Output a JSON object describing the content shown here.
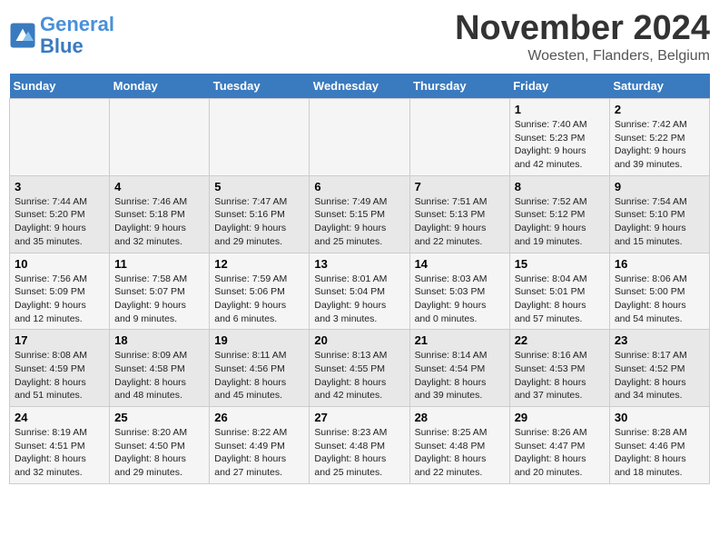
{
  "header": {
    "logo_line1": "General",
    "logo_line2": "Blue",
    "month": "November 2024",
    "location": "Woesten, Flanders, Belgium"
  },
  "days_of_week": [
    "Sunday",
    "Monday",
    "Tuesday",
    "Wednesday",
    "Thursday",
    "Friday",
    "Saturday"
  ],
  "weeks": [
    [
      {
        "day": "",
        "info": ""
      },
      {
        "day": "",
        "info": ""
      },
      {
        "day": "",
        "info": ""
      },
      {
        "day": "",
        "info": ""
      },
      {
        "day": "",
        "info": ""
      },
      {
        "day": "1",
        "info": "Sunrise: 7:40 AM\nSunset: 5:23 PM\nDaylight: 9 hours\nand 42 minutes."
      },
      {
        "day": "2",
        "info": "Sunrise: 7:42 AM\nSunset: 5:22 PM\nDaylight: 9 hours\nand 39 minutes."
      }
    ],
    [
      {
        "day": "3",
        "info": "Sunrise: 7:44 AM\nSunset: 5:20 PM\nDaylight: 9 hours\nand 35 minutes."
      },
      {
        "day": "4",
        "info": "Sunrise: 7:46 AM\nSunset: 5:18 PM\nDaylight: 9 hours\nand 32 minutes."
      },
      {
        "day": "5",
        "info": "Sunrise: 7:47 AM\nSunset: 5:16 PM\nDaylight: 9 hours\nand 29 minutes."
      },
      {
        "day": "6",
        "info": "Sunrise: 7:49 AM\nSunset: 5:15 PM\nDaylight: 9 hours\nand 25 minutes."
      },
      {
        "day": "7",
        "info": "Sunrise: 7:51 AM\nSunset: 5:13 PM\nDaylight: 9 hours\nand 22 minutes."
      },
      {
        "day": "8",
        "info": "Sunrise: 7:52 AM\nSunset: 5:12 PM\nDaylight: 9 hours\nand 19 minutes."
      },
      {
        "day": "9",
        "info": "Sunrise: 7:54 AM\nSunset: 5:10 PM\nDaylight: 9 hours\nand 15 minutes."
      }
    ],
    [
      {
        "day": "10",
        "info": "Sunrise: 7:56 AM\nSunset: 5:09 PM\nDaylight: 9 hours\nand 12 minutes."
      },
      {
        "day": "11",
        "info": "Sunrise: 7:58 AM\nSunset: 5:07 PM\nDaylight: 9 hours\nand 9 minutes."
      },
      {
        "day": "12",
        "info": "Sunrise: 7:59 AM\nSunset: 5:06 PM\nDaylight: 9 hours\nand 6 minutes."
      },
      {
        "day": "13",
        "info": "Sunrise: 8:01 AM\nSunset: 5:04 PM\nDaylight: 9 hours\nand 3 minutes."
      },
      {
        "day": "14",
        "info": "Sunrise: 8:03 AM\nSunset: 5:03 PM\nDaylight: 9 hours\nand 0 minutes."
      },
      {
        "day": "15",
        "info": "Sunrise: 8:04 AM\nSunset: 5:01 PM\nDaylight: 8 hours\nand 57 minutes."
      },
      {
        "day": "16",
        "info": "Sunrise: 8:06 AM\nSunset: 5:00 PM\nDaylight: 8 hours\nand 54 minutes."
      }
    ],
    [
      {
        "day": "17",
        "info": "Sunrise: 8:08 AM\nSunset: 4:59 PM\nDaylight: 8 hours\nand 51 minutes."
      },
      {
        "day": "18",
        "info": "Sunrise: 8:09 AM\nSunset: 4:58 PM\nDaylight: 8 hours\nand 48 minutes."
      },
      {
        "day": "19",
        "info": "Sunrise: 8:11 AM\nSunset: 4:56 PM\nDaylight: 8 hours\nand 45 minutes."
      },
      {
        "day": "20",
        "info": "Sunrise: 8:13 AM\nSunset: 4:55 PM\nDaylight: 8 hours\nand 42 minutes."
      },
      {
        "day": "21",
        "info": "Sunrise: 8:14 AM\nSunset: 4:54 PM\nDaylight: 8 hours\nand 39 minutes."
      },
      {
        "day": "22",
        "info": "Sunrise: 8:16 AM\nSunset: 4:53 PM\nDaylight: 8 hours\nand 37 minutes."
      },
      {
        "day": "23",
        "info": "Sunrise: 8:17 AM\nSunset: 4:52 PM\nDaylight: 8 hours\nand 34 minutes."
      }
    ],
    [
      {
        "day": "24",
        "info": "Sunrise: 8:19 AM\nSunset: 4:51 PM\nDaylight: 8 hours\nand 32 minutes."
      },
      {
        "day": "25",
        "info": "Sunrise: 8:20 AM\nSunset: 4:50 PM\nDaylight: 8 hours\nand 29 minutes."
      },
      {
        "day": "26",
        "info": "Sunrise: 8:22 AM\nSunset: 4:49 PM\nDaylight: 8 hours\nand 27 minutes."
      },
      {
        "day": "27",
        "info": "Sunrise: 8:23 AM\nSunset: 4:48 PM\nDaylight: 8 hours\nand 25 minutes."
      },
      {
        "day": "28",
        "info": "Sunrise: 8:25 AM\nSunset: 4:48 PM\nDaylight: 8 hours\nand 22 minutes."
      },
      {
        "day": "29",
        "info": "Sunrise: 8:26 AM\nSunset: 4:47 PM\nDaylight: 8 hours\nand 20 minutes."
      },
      {
        "day": "30",
        "info": "Sunrise: 8:28 AM\nSunset: 4:46 PM\nDaylight: 8 hours\nand 18 minutes."
      }
    ]
  ]
}
